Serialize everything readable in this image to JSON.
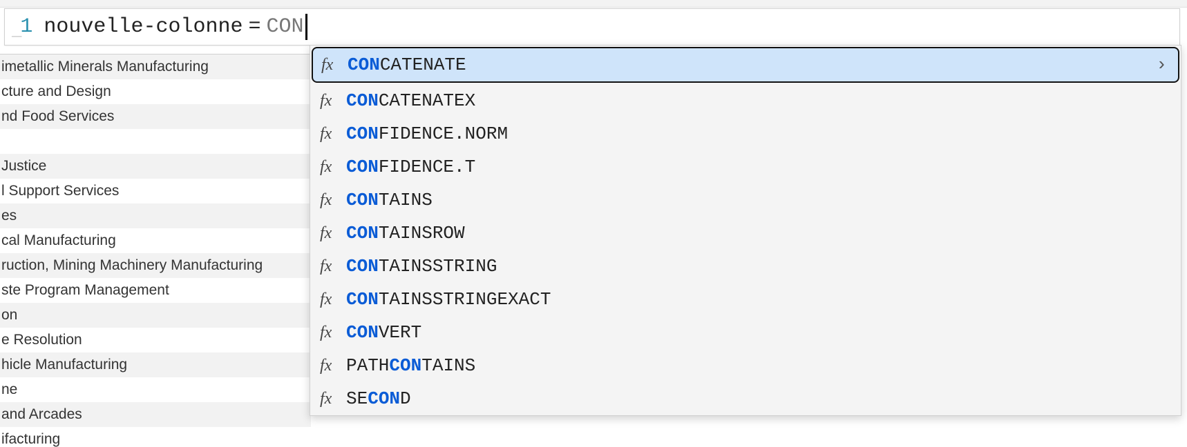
{
  "formula": {
    "line_number": "1",
    "column_name": "nouvelle-colonne",
    "eq": "=",
    "typed": "CON"
  },
  "background_rows": [
    "imetallic Minerals Manufacturing",
    "cture and Design",
    "nd Food Services",
    "",
    "Justice",
    "l Support Services",
    "es",
    "cal Manufacturing",
    "ruction, Mining Machinery Manufacturing",
    "ste Program Management",
    "on",
    "e Resolution",
    "hicle Manufacturing",
    "ne",
    "and Arcades",
    "ifacturing"
  ],
  "autocomplete": {
    "fx_label": "fx",
    "selected_index": 0,
    "items": [
      {
        "pre": "",
        "match": "CON",
        "post": "CATENATE"
      },
      {
        "pre": "",
        "match": "CON",
        "post": "CATENATEX"
      },
      {
        "pre": "",
        "match": "CON",
        "post": "FIDENCE.NORM"
      },
      {
        "pre": "",
        "match": "CON",
        "post": "FIDENCE.T"
      },
      {
        "pre": "",
        "match": "CON",
        "post": "TAINS"
      },
      {
        "pre": "",
        "match": "CON",
        "post": "TAINSROW"
      },
      {
        "pre": "",
        "match": "CON",
        "post": "TAINSSTRING"
      },
      {
        "pre": "",
        "match": "CON",
        "post": "TAINSSTRINGEXACT"
      },
      {
        "pre": "",
        "match": "CON",
        "post": "VERT"
      },
      {
        "pre": "PATH",
        "match": "CON",
        "post": "TAINS"
      },
      {
        "pre": "SE",
        "match": "CON",
        "post": "D"
      }
    ]
  }
}
